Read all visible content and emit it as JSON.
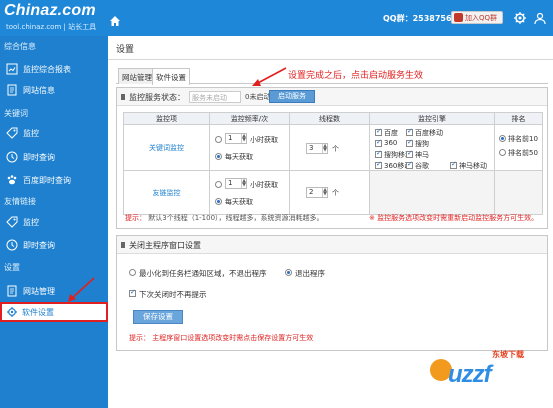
{
  "topbar": {
    "logo_main": "Chinaz.com",
    "logo_sub": "tool.chinaz.com | 站长工具",
    "qq_group": "QQ群：25387567",
    "qq_join": "加入QQ群"
  },
  "sidebar": {
    "cat_info": "综合信息",
    "item_report": "监控综合报表",
    "item_site_info": "网站信息",
    "cat_keyword": "关键词",
    "item_kw_monitor": "监控",
    "item_kw_realtime": "即时查询",
    "item_baidu_realtime": "百度即时查询",
    "cat_links": "友情链接",
    "item_link_monitor": "监控",
    "item_link_realtime": "即时查询",
    "cat_settings": "设置",
    "item_site_manage": "网站管理",
    "item_software_settings": "软件设置"
  },
  "main": {
    "page_title": "设置",
    "tabs": [
      "网站管理",
      "软件设置"
    ],
    "annotation": "设置完成之后，点击启动服务生效",
    "monitor": {
      "title": "监控服务状态：",
      "status_placeholder": "服务未启动",
      "state_text": "0未启动",
      "start_button": "启动服务",
      "headers": [
        "监控项",
        "监控频率/次",
        "线程数",
        "监控引擎",
        "排名"
      ],
      "rows": [
        {
          "name": "关键词监控",
          "freq_value": "1",
          "freq_unit": "小时获取",
          "freq_daily": "每天获取",
          "threads": "3",
          "threads_unit": "个",
          "engines": [
            "百度",
            "百度移动",
            "360",
            "搜狗",
            "搜狗移动",
            "神马",
            "360移动",
            "谷歌",
            "神马移动",
            "Bing",
            "雅虎",
            "有道"
          ],
          "rank_top": "排名前10",
          "rank_top50": "排名前50"
        },
        {
          "name": "友链监控",
          "freq_value": "1",
          "freq_unit": "小时获取",
          "freq_daily": "每天获取",
          "threads": "2",
          "threads_unit": "个"
        }
      ],
      "tip_label": "提示：",
      "tip_text": "默认3个线程（1-100），线程越多，系统资源消耗越多。",
      "tip_right": "※ 监控服务选项改变时需重新启动监控服务方可生效。"
    },
    "close": {
      "title": "关闭主程序窗口设置",
      "option_minimize": "最小化到任务栏通知区域，不退出程序",
      "option_exit": "退出程序",
      "show_again": "下次关闭时不再提示",
      "save_button": "保存设置",
      "tip_label": "提示：",
      "tip_text": "主程序窗口设置选项改变时需点击保存设置方可生效"
    }
  },
  "watermark": {
    "logo": "uzzf",
    "cn": "东坡下载"
  }
}
